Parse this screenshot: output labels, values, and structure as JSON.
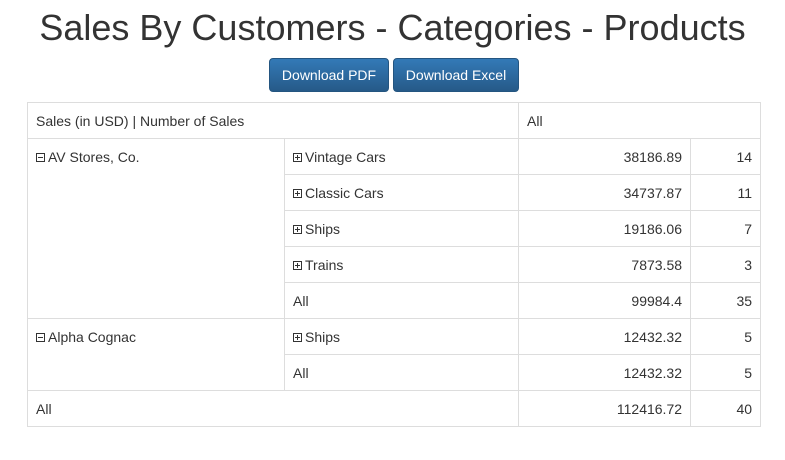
{
  "page": {
    "title": "Sales By Customers - Categories - Products"
  },
  "buttons": {
    "download_pdf": "Download PDF",
    "download_excel": "Download Excel"
  },
  "pivot": {
    "header_label": "Sales (in USD) | Number of Sales",
    "header_column": "All",
    "customers": [
      {
        "name": "AV Stores, Co.",
        "rows": [
          {
            "category": "Vintage Cars",
            "sales": "38186.89",
            "count": "14"
          },
          {
            "category": "Classic Cars",
            "sales": "34737.87",
            "count": "11"
          },
          {
            "category": "Ships",
            "sales": "19186.06",
            "count": "7"
          },
          {
            "category": "Trains",
            "sales": "7873.58",
            "count": "3"
          }
        ],
        "subtotal": {
          "label": "All",
          "sales": "99984.4",
          "count": "35"
        }
      },
      {
        "name": "Alpha Cognac",
        "rows": [
          {
            "category": "Ships",
            "sales": "12432.32",
            "count": "5"
          }
        ],
        "subtotal": {
          "label": "All",
          "sales": "12432.32",
          "count": "5"
        }
      }
    ],
    "grand_total": {
      "label": "All",
      "sales": "112416.72",
      "count": "40"
    }
  },
  "icons": {
    "collapse": "minus-square-icon",
    "expand": "plus-square-icon"
  },
  "colors": {
    "button_bg": "#337ab7",
    "border": "#dddddd",
    "text": "#333333"
  }
}
